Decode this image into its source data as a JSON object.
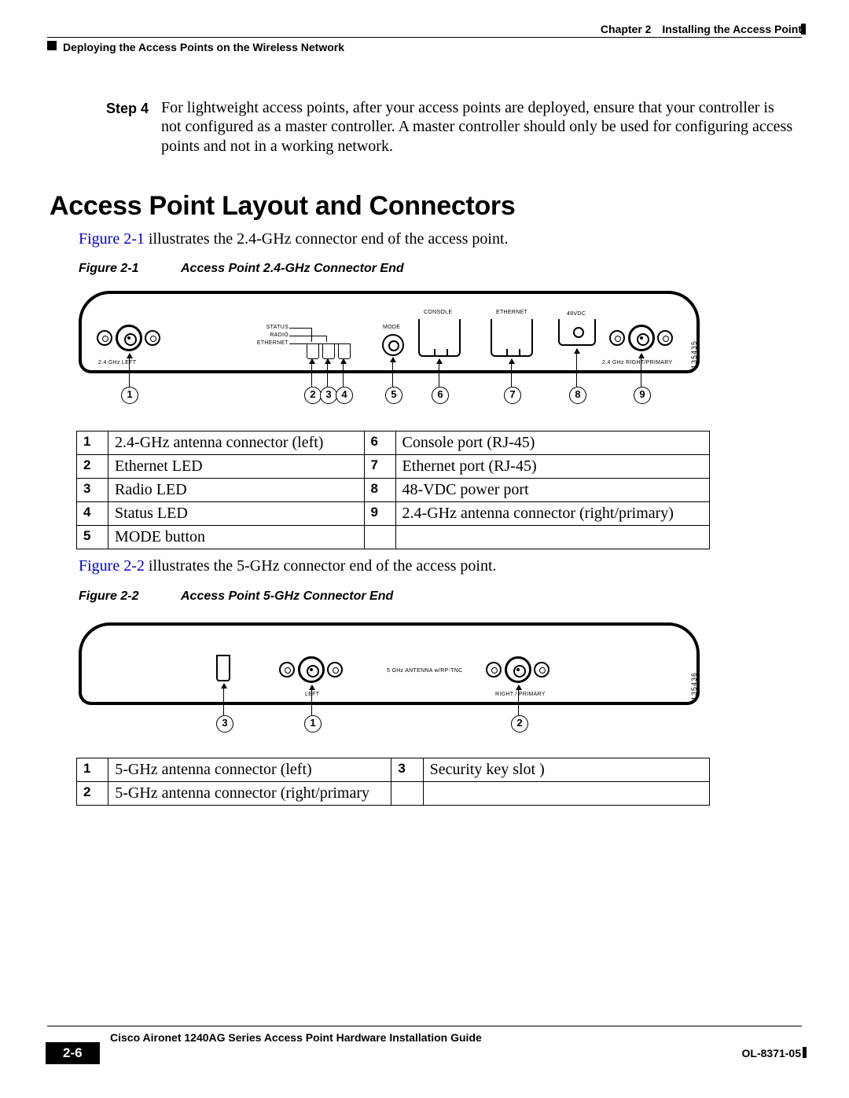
{
  "header": {
    "chapter_label": "Chapter 2",
    "chapter_title": "Installing the Access Point",
    "section_title": "Deploying the Access Points on the Wireless Network"
  },
  "step": {
    "label": "Step 4",
    "text": "For lightweight access points, after your access points are deployed, ensure that your controller is not configured as a master controller. A master controller should only be used for configuring access points and not in a working network."
  },
  "heading": "Access Point Layout and Connectors",
  "intro1": {
    "link": "Figure 2-1",
    "rest": " illustrates the 2.4-GHz connector end of the access point."
  },
  "figcap1": {
    "num": "Figure 2-1",
    "title": "Access Point 2.4-GHz Connector End"
  },
  "fig1": {
    "labels": {
      "status": "STATUS",
      "radio": "RADIO",
      "ethernet": "ETHERNET",
      "mode": "MODE",
      "console": "CONSOLE",
      "ethernet_port": "ETHERNET",
      "vdc": "48VDC",
      "left": "2.4 GHz LEFT",
      "right": "2.4 GHz RIGHT/PRIMARY",
      "id": "135435"
    },
    "callouts": [
      "1",
      "2",
      "3",
      "4",
      "5",
      "6",
      "7",
      "8",
      "9"
    ]
  },
  "table1": [
    {
      "n": "1",
      "d": "2.4-GHz antenna connector (left)",
      "n2": "6",
      "d2": "Console port (RJ-45)"
    },
    {
      "n": "2",
      "d": "Ethernet LED",
      "n2": "7",
      "d2": "Ethernet port (RJ-45)"
    },
    {
      "n": "3",
      "d": "Radio LED",
      "n2": "8",
      "d2": "48-VDC power port"
    },
    {
      "n": "4",
      "d": "Status LED",
      "n2": "9",
      "d2": "2.4-GHz antenna connector (right/primary)"
    },
    {
      "n": "5",
      "d": "MODE button",
      "n2": "",
      "d2": ""
    }
  ],
  "intro2": {
    "link": "Figure 2-2",
    "rest": " illustrates the 5-GHz connector end of the access point."
  },
  "figcap2": {
    "num": "Figure 2-2",
    "title": "Access Point 5-GHz Connector End"
  },
  "fig2": {
    "labels": {
      "ant": "5 GHz ANTENNA w/RP-TNC",
      "left": "LEFT",
      "right": "RIGHT / PRIMARY",
      "id": "135436"
    },
    "callouts": [
      "3",
      "1",
      "2"
    ]
  },
  "table2": [
    {
      "n": "1",
      "d": "5-GHz antenna connector (left)",
      "n2": "3",
      "d2": "Security key slot )"
    },
    {
      "n": "2",
      "d": "5-GHz antenna connector (right/primary",
      "n2": "",
      "d2": ""
    }
  ],
  "footer": {
    "guide": "Cisco Aironet 1240AG Series Access Point Hardware Installation Guide",
    "page": "2-6",
    "doc": "OL-8371-05"
  }
}
